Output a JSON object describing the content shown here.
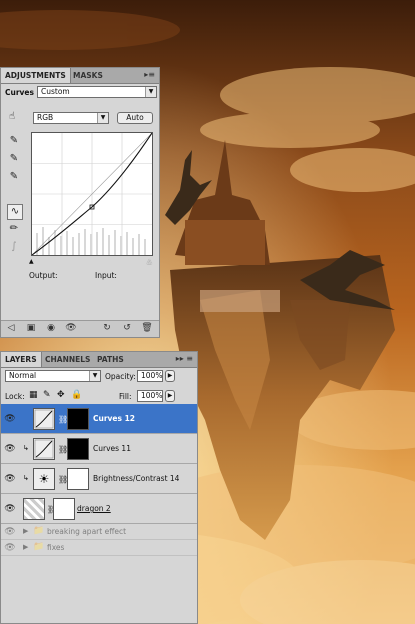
{
  "adjustments": {
    "tabs": [
      "ADJUSTMENTS",
      "MASKS"
    ],
    "adjustment_label": "Curves",
    "preset_value": "Custom",
    "channel_value": "RGB",
    "auto_label": "Auto",
    "output_label": "Output:",
    "input_label": "Input:"
  },
  "layers": {
    "tabs": [
      "LAYERS",
      "CHANNELS",
      "PATHS"
    ],
    "blend_mode": "Normal",
    "opacity_label": "Opacity:",
    "opacity_value": "100%",
    "lock_label": "Lock:",
    "fill_label": "Fill:",
    "fill_value": "100%",
    "items": [
      {
        "name": "Curves 12",
        "selected": true
      },
      {
        "name": "Curves 11",
        "selected": false
      },
      {
        "name": "Brightness/Contrast 14",
        "selected": false
      },
      {
        "name": "dragon 2",
        "selected": false
      },
      {
        "name": "breaking apart effect",
        "selected": false
      },
      {
        "name": "fixes",
        "selected": false
      }
    ]
  },
  "colors": {
    "panel_bg": "#d6d6d6",
    "selection_blue": "#3b74c8",
    "sky_dark": "#4a230c",
    "sky_bright": "#f6c26c"
  }
}
